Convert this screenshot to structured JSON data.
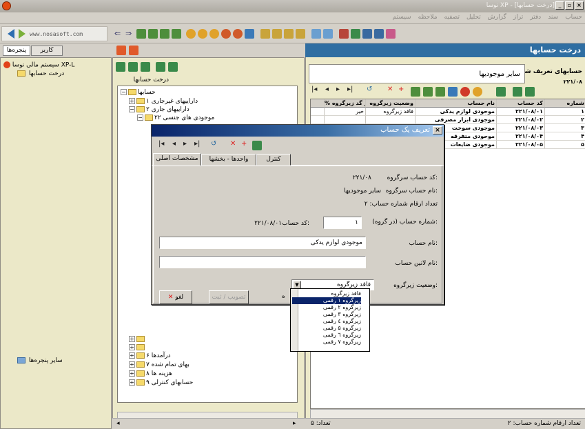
{
  "window": {
    "title": "نوسا XP - [درخت حسابها]"
  },
  "menu": [
    "حساب",
    "سند",
    "دفتر",
    "تراز",
    "گزارش",
    "تحلیل",
    "تصفیه",
    "ملاحظه",
    "سیستم"
  ],
  "logo": {
    "text": "www.nosasoft.com"
  },
  "left": {
    "tabs": [
      "پنجره‌ها",
      "کاربر"
    ],
    "tree_root": "سیستم مالی نوسا XP-L",
    "tree_child": "درخت حسابها",
    "other_windows": "سایر پنجره‌ها"
  },
  "mid": {
    "header_label": "درخت حسابها",
    "tree": [
      {
        "label": "حسابها",
        "indent": 0
      },
      {
        "label": "داراییهای غیرجاری  ۱",
        "indent": 1
      },
      {
        "label": "داراییهای جاری  ۲",
        "indent": 1
      },
      {
        "label": "موجودی های جنسی  ۲۲",
        "indent": 2
      },
      {
        "label": "درآمدها  ۶",
        "indent": 1
      },
      {
        "label": "بهای تمام شده  ۷",
        "indent": 1
      },
      {
        "label": "هزینه ها  ۸",
        "indent": 1
      },
      {
        "label": "حسابهای کنترلی  ۹",
        "indent": 1
      }
    ]
  },
  "right": {
    "title": "درخت حسابها",
    "label": "حسابهای تعریف شده در زیرگروه",
    "code": "۲۲۱/۰۸",
    "value": "سایر موجودیها",
    "columns": [
      "شماره",
      "کد حساب",
      "نام حساب",
      "وضعیت زیرگروه",
      "% در گد زیرگروه"
    ],
    "rows": [
      [
        "۱",
        "۲۲۱/۰۸/۰۱",
        "موجودی لوازم یدکی",
        "فاقد زیرگروه",
        "خیر"
      ],
      [
        "۲",
        "۲۲۱/۰۸/۰۲",
        "موجودی ابزار مصرفی",
        "",
        ""
      ],
      [
        "۳",
        "۲۲۱/۰۸/۰۳",
        "موجودی سوخت",
        "",
        ""
      ],
      [
        "۴",
        "۲۲۱/۰۸/۰۴",
        "موجودی متفرقه",
        "",
        ""
      ],
      [
        "۵",
        "۲۲۱/۰۸/۰۵",
        "موجودی ضایعات",
        "",
        ""
      ]
    ],
    "status": "تعداد ارقام شماره حساب: ۲",
    "count": "تعداد: ۵"
  },
  "dialog": {
    "title": "تعریف یک حساب",
    "close": "×",
    "tabs": [
      "مشخصات اصلی",
      "واحدها - بخشها",
      "کنترل"
    ],
    "parent_code_label": "کد حساب سرگروه:",
    "parent_code": "۲۲۱/۰۸",
    "parent_name_label": "نام حساب سرگروه:",
    "parent_name": "سایر موجودیها",
    "digits": "تعداد ارقام شماره حساب: ۲",
    "number_label": "شماره حساب (در گروه):",
    "number_value": "۱",
    "code_label": "کد حساب:",
    "code_value": "۲۲۱/۰۸/۰۱",
    "name_label": "نام حساب:",
    "name_value": "موجودی لوازم یدکی",
    "latin_label": "نام لاتین حساب:",
    "latin_value": "",
    "subgroup_label": "وضعیت زیرگروه:",
    "subgroup_value": "فاقد زیرگروه",
    "confirm": "تصویب / ثبت",
    "cancel": "لغو",
    "partial": "ه",
    "options": [
      "فاقد زیرگروه",
      "زیرگروه ۱ رقمی",
      "زیرگروه ۲ رقمی",
      "زیرگروه ۳ رقمی",
      "زیرگروه ٤ رقمی",
      "زیرگروه ۵ رقمی",
      "زیرگروه ٦ رقمی",
      "زیرگروه ۷ رقمی"
    ],
    "selected_option": 1
  },
  "colors": {
    "header_blue": "#2f6ea2",
    "dialog_title": "#0a246a",
    "pane_bg": "#ece9c9"
  }
}
